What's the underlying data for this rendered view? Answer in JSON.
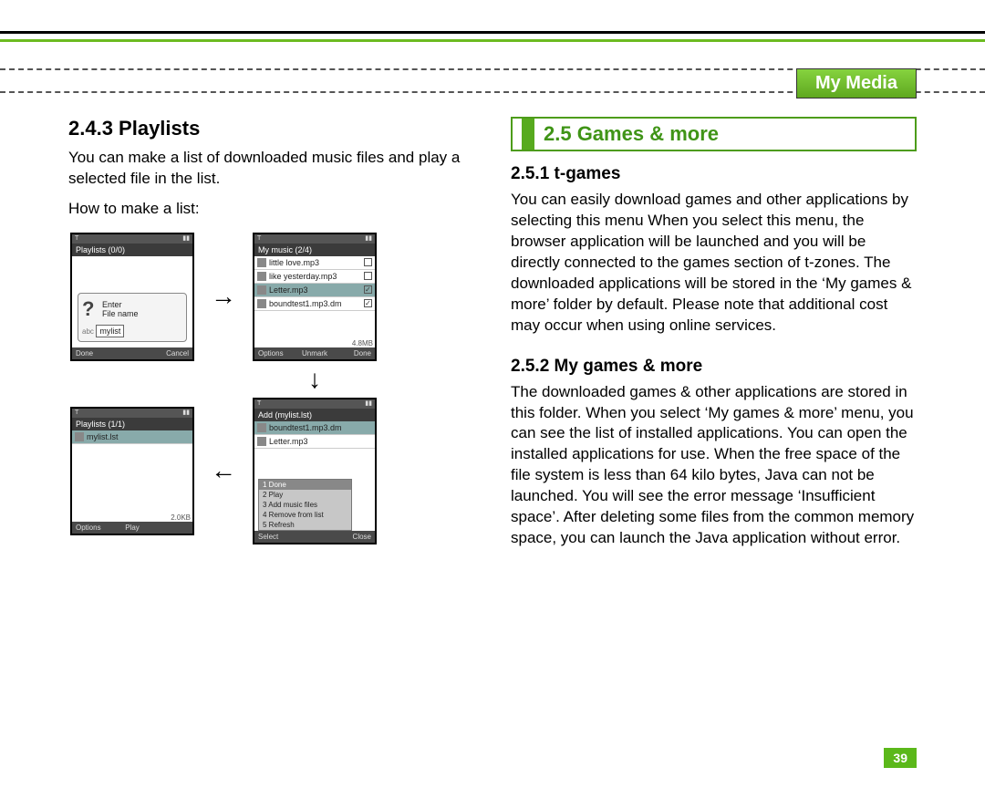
{
  "chapter": "My Media",
  "page_number": "39",
  "left": {
    "h243": "2.4.3 Playlists",
    "para1": "You can make a list of downloaded music files and play a selected file in the list.",
    "para2": "How to make a list:",
    "screen1": {
      "title": "Playlists (0/0)",
      "dlg_line1": "Enter",
      "dlg_line2": "File name",
      "dlg_mode": "abc",
      "dlg_input": "mylist",
      "soft_left": "Done",
      "soft_right": "Cancel"
    },
    "screen2": {
      "title": "My music (2/4)",
      "rows": [
        {
          "label": "boundtest1.mp3.dm",
          "checked": true
        },
        {
          "label": "Letter.mp3",
          "checked": true,
          "selected": true
        },
        {
          "label": "like yesterday.mp3",
          "checked": false
        },
        {
          "label": "little love.mp3",
          "checked": false
        }
      ],
      "size": "4.8MB",
      "soft_left": "Options",
      "soft_mid": "Unmark",
      "soft_right": "Done"
    },
    "screen3": {
      "title": "Playlists (1/1)",
      "rows": [
        {
          "label": "mylist.lst",
          "selected": true
        }
      ],
      "size": "2.0KB",
      "soft_left": "Options",
      "soft_mid": "Play",
      "soft_right": ""
    },
    "screen4": {
      "title": "Add (mylist.lst)",
      "rows": [
        {
          "label": "boundtest1.mp3.dm",
          "selected": true
        },
        {
          "label": "Letter.mp3"
        }
      ],
      "menu": [
        "1 Done",
        "2 Play",
        "3 Add music files",
        "4 Remove from list",
        "5 Refresh"
      ],
      "menu_sel": 0,
      "soft_left": "Select",
      "soft_right": "Close"
    }
  },
  "right": {
    "banner": "2.5 Games & more",
    "h251": "2.5.1 t-games",
    "p251": "You can easily download games and other applications by selecting this menu When you select this menu, the browser application will be launched and you will be directly connected to the games section of t-zones. The downloaded applications will be stored in the ‘My games & more’ folder by default. Please note that additional cost may occur when using online services.",
    "h252": "2.5.2 My games & more",
    "p252": "The downloaded games & other applications are stored in this folder. When you select ‘My games & more’ menu, you can see the list of installed applications. You can open the installed applications for use. When the free space of the file system is less than 64 kilo bytes, Java can not be launched. You will see the error message ‘Insufficient space’. After deleting some files from the common memory space, you can launch the Java application without error."
  }
}
